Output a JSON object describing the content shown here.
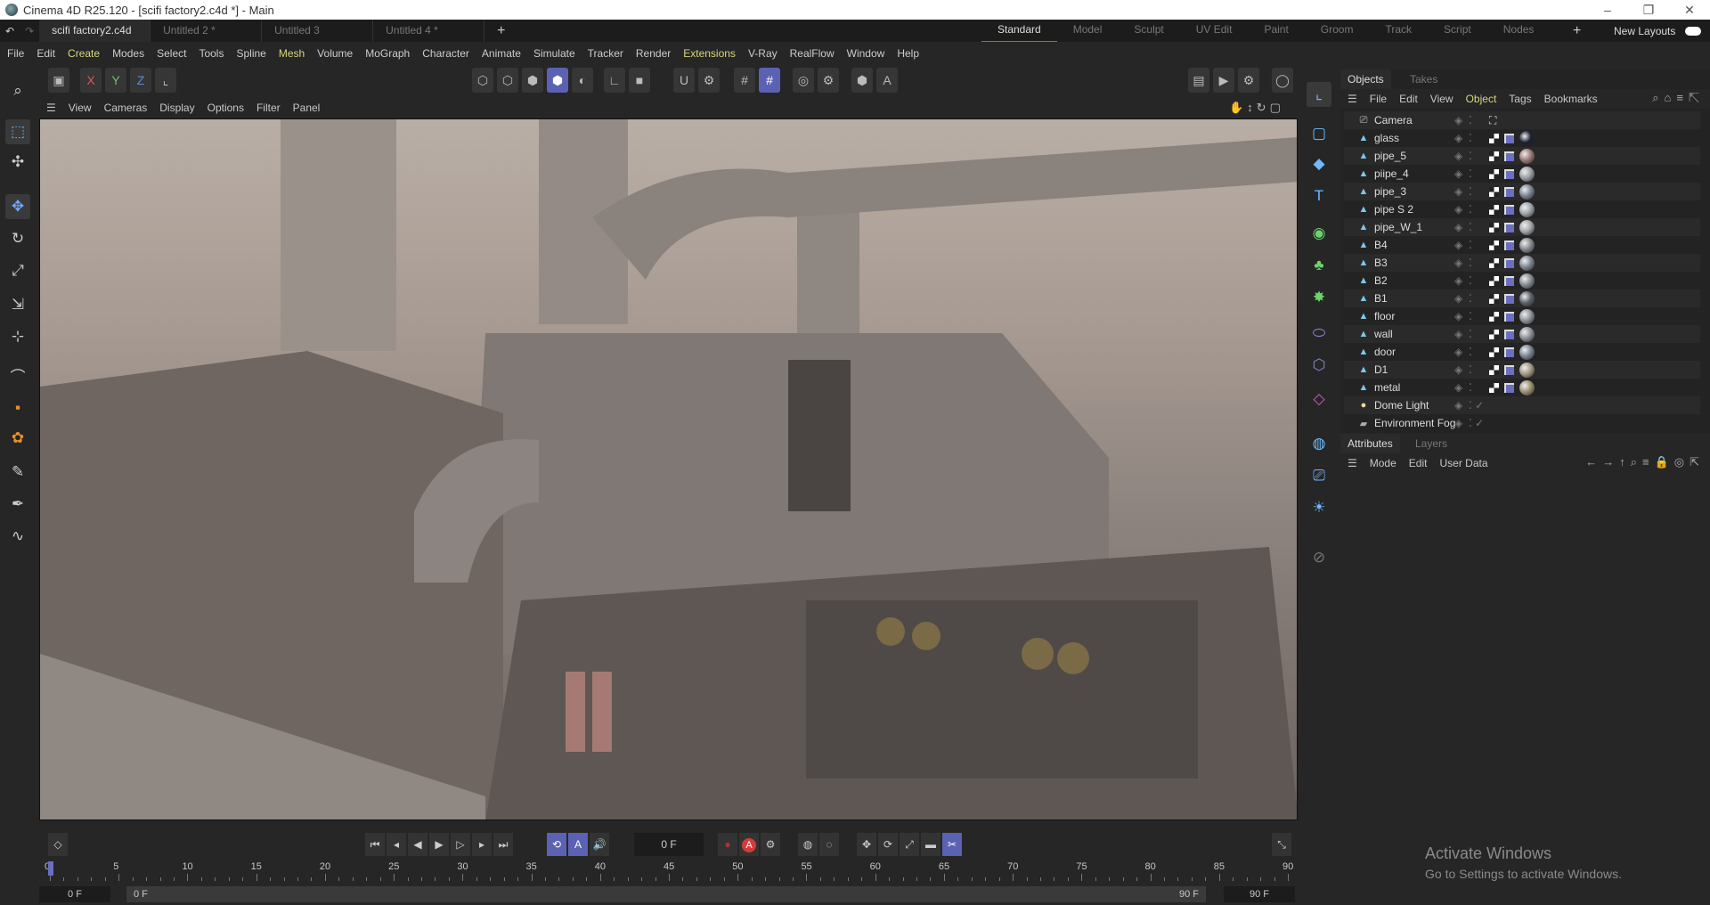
{
  "window": {
    "title": "Cinema 4D R25.120 - [scifi factory2.c4d *] - Main",
    "controls": [
      "–",
      "❐",
      "✕"
    ]
  },
  "doc_tabs": [
    {
      "label": "scifi factory2.c4d *",
      "active": true
    },
    {
      "label": "Untitled 2 *"
    },
    {
      "label": "Untitled 3"
    },
    {
      "label": "Untitled 4 *"
    }
  ],
  "layouts": {
    "items": [
      "Standard",
      "Model",
      "Sculpt",
      "UV Edit",
      "Paint",
      "Groom",
      "Track",
      "Script",
      "Nodes"
    ],
    "active": "Standard",
    "new_layouts": "New Layouts"
  },
  "menu": [
    "File",
    "Edit",
    "Create",
    "Modes",
    "Select",
    "Tools",
    "Spline",
    "Mesh",
    "Volume",
    "MoGraph",
    "Character",
    "Animate",
    "Simulate",
    "Tracker",
    "Render",
    "Extensions",
    "V-Ray",
    "RealFlow",
    "Window",
    "Help"
  ],
  "menu_highlighted": [
    "Create",
    "Mesh",
    "Extensions"
  ],
  "toolbar": {
    "axis": [
      "X",
      "Y",
      "Z"
    ]
  },
  "viewport_menu": [
    "View",
    "Cameras",
    "Display",
    "Options",
    "Filter",
    "Panel"
  ],
  "objects_panel": {
    "tabs": [
      "Objects",
      "Takes"
    ],
    "menu": [
      "File",
      "Edit",
      "View",
      "Object",
      "Tags",
      "Bookmarks"
    ],
    "objects": [
      {
        "name": "Camera",
        "icon": "camera"
      },
      {
        "name": "glass",
        "icon": "polygon",
        "material": "#1c2130"
      },
      {
        "name": "pipe_5",
        "icon": "polygon",
        "material": "#9a7a78"
      },
      {
        "name": "piipe_4",
        "icon": "polygon",
        "material": "#9aa0a6"
      },
      {
        "name": "pipe_3",
        "icon": "polygon",
        "material": "#7b8594"
      },
      {
        "name": "pipe S 2",
        "icon": "polygon",
        "material": "#a0a5aa"
      },
      {
        "name": "pipe_W_1",
        "icon": "polygon",
        "material": "#a4a6a8"
      },
      {
        "name": "B4",
        "icon": "polygon",
        "material": "#858a90"
      },
      {
        "name": "B3",
        "icon": "polygon",
        "material": "#7f8792"
      },
      {
        "name": "B2",
        "icon": "polygon",
        "material": "#858b92"
      },
      {
        "name": "B1",
        "icon": "polygon",
        "material": "#5c636b"
      },
      {
        "name": "floor",
        "icon": "polygon",
        "material": "#8d9399"
      },
      {
        "name": "wall",
        "icon": "polygon",
        "material": "#8a9096"
      },
      {
        "name": "door",
        "icon": "polygon",
        "material": "#7a8594"
      },
      {
        "name": "D1",
        "icon": "polygon",
        "material": "#a39a80"
      },
      {
        "name": "metal",
        "icon": "polygon",
        "material": "#9c9272"
      },
      {
        "name": "Dome Light",
        "icon": "dome-light"
      },
      {
        "name": "Environment Fog",
        "icon": "fog"
      }
    ]
  },
  "attributes_panel": {
    "tabs": [
      "Attributes",
      "Layers"
    ],
    "menu": [
      "Mode",
      "Edit",
      "User Data"
    ]
  },
  "timeline": {
    "current_frame": "0 F",
    "start": "0 F",
    "end": "90 F",
    "range_start": "0 F",
    "range_end": "90 F",
    "ticks": [
      0,
      5,
      10,
      15,
      20,
      25,
      30,
      35,
      40,
      45,
      50,
      55,
      60,
      65,
      70,
      75,
      80,
      85,
      90
    ]
  },
  "watermark": {
    "title": "Activate Windows",
    "subtitle": "Go to Settings to activate Windows."
  },
  "colors": {
    "accent": "#5b62b3",
    "highlight_menu": "#d8d67a",
    "record": "#d43c3c"
  }
}
